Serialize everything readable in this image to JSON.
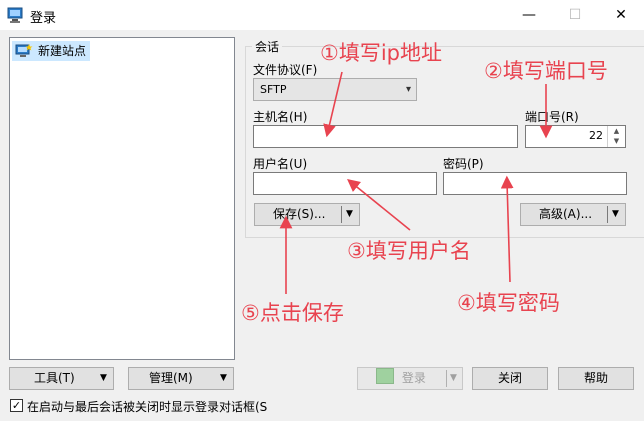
{
  "window": {
    "title": "登录",
    "minimize": "—",
    "maximize": "☐",
    "close": "✕"
  },
  "tree": {
    "items": [
      {
        "label": "新建站点"
      }
    ]
  },
  "session": {
    "group_label": "会话",
    "protocol_label": "文件协议(F)",
    "protocol_value": "SFTP",
    "host_label": "主机名(H)",
    "host_value": "",
    "port_label": "端口号(R)",
    "port_value": "22",
    "user_label": "用户名(U)",
    "user_value": "",
    "password_label": "密码(P)",
    "password_value": "",
    "save_button": "保存(S)...",
    "advanced_button": "高级(A)..."
  },
  "bottom": {
    "tools_button": "工具(T)",
    "manage_button": "管理(M)",
    "login_button": "登录",
    "close_button": "关闭",
    "help_button": "帮助",
    "show_dialog_label": "在启动与最后会话被关闭时显示登录对话框(S",
    "show_dialog_checked": true
  },
  "annotations": {
    "host": "①填写ip地址",
    "port": "②填写端口号",
    "user": "③填写用户名",
    "password": "④填写密码",
    "save": "⑤点击保存"
  },
  "colors": {
    "annotation": "#e8434f",
    "selection": "#cce8ff"
  }
}
